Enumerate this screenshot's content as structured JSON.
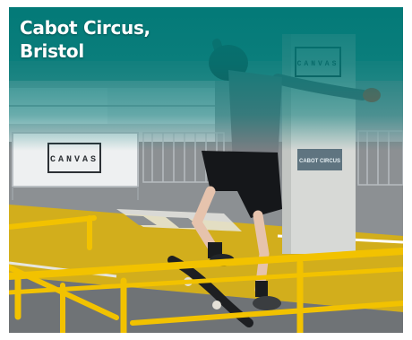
{
  "caption": {
    "line1": "Cabot Circus,",
    "line2": "Bristol"
  },
  "signs": {
    "barrier": "CANVAS",
    "pillar": "CANVAS",
    "pillar_plate": "CABOT CIRCUS"
  },
  "colors": {
    "teal_overlay": "#00807d",
    "rail_yellow": "#f2c200",
    "floor_yellow": "#d8b500"
  }
}
